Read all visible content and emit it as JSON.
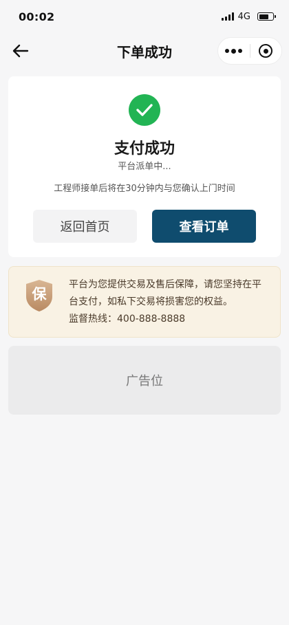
{
  "status_bar": {
    "time": "00:02",
    "network": "4G"
  },
  "nav": {
    "title": "下单成功",
    "back_icon": "arrow-left-icon",
    "more_icon": "more-dots-icon",
    "target_icon": "target-icon"
  },
  "success": {
    "icon": "check-icon",
    "icon_color": "#22b454",
    "title": "支付成功",
    "subtitle": "平台派单中...",
    "note": "工程师接单后将在30分钟内与您确认上门时间",
    "home_button": "返回首页",
    "order_button": "查看订单",
    "order_button_color": "#0f4c6e"
  },
  "guarantee": {
    "badge": "保",
    "text": "平台为您提供交易及售后保障，请您坚持在平台支付，如私下交易将损害您的权益。",
    "hotline": "监督热线：400-888-8888",
    "background_color": "#f9f2e4"
  },
  "ad": {
    "label": "广告位"
  }
}
